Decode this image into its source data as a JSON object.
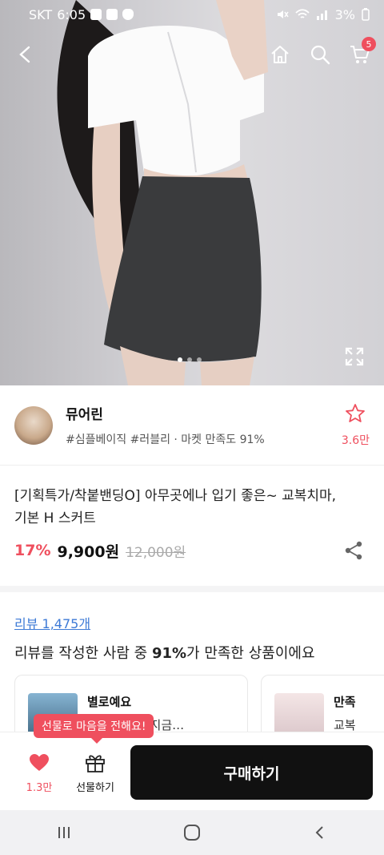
{
  "status_bar": {
    "carrier": "SKT",
    "time": "6:05",
    "battery": "3%"
  },
  "top_nav": {
    "cart_count": "5"
  },
  "gallery": {
    "total": 3,
    "active_index": 0
  },
  "shop": {
    "name": "뮤어린",
    "tags": "#심플베이직 #러블리 · 마켓 만족도 91%",
    "favorite_count": "3.6만"
  },
  "product": {
    "title": "[기획특가/착붙밴딩O] 아무곳에나 입기 좋은~ 교복치마, 기본 H 스커트",
    "discount": "17%",
    "price": "9,900원",
    "original_price": "12,000원"
  },
  "reviews": {
    "link_label": "리뷰 1,475개",
    "summary_prefix": "리뷰를 작성한 사람 중 ",
    "summary_highlight": "91%",
    "summary_suffix": "가 만족한 상품이에요",
    "cards": [
      {
        "title": "별로예요",
        "body": "아요 그래서 지금…"
      },
      {
        "title": "만족",
        "body": "교복"
      }
    ]
  },
  "tooltip": "선물로 마음을 전해요!",
  "bottom_bar": {
    "like_count": "1.3만",
    "gift_label": "선물하기",
    "buy_label": "구매하기"
  },
  "colors": {
    "accent": "#ef4f5e",
    "link": "#3d7ad6",
    "buy_button": "#111111"
  }
}
